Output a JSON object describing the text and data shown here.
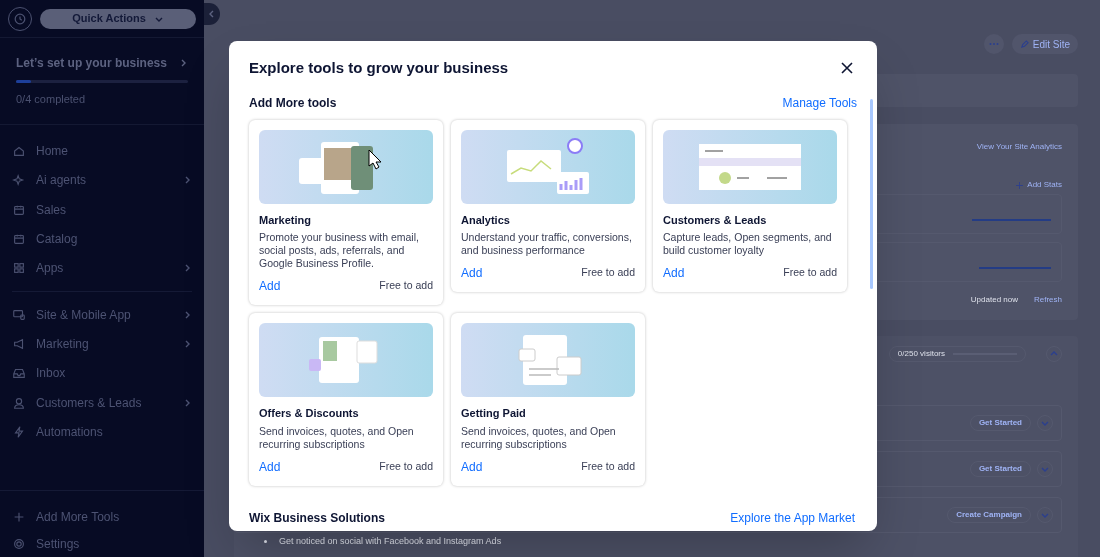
{
  "sidebar": {
    "quick_actions": "Quick Actions",
    "setup": {
      "title": "Let’s set up your business",
      "level": 0.09,
      "status": "0/4 completed"
    },
    "nav_groups": [
      [
        {
          "label": "Home",
          "kind": "link"
        },
        {
          "label": "Ai agents",
          "kind": "submenu"
        },
        {
          "label": "Sales",
          "kind": "link"
        },
        {
          "label": "Catalog",
          "kind": "link"
        },
        {
          "label": "Apps",
          "kind": "submenu"
        }
      ],
      [
        {
          "label": "Site & Mobile App",
          "kind": "submenu"
        },
        {
          "label": "Marketing",
          "kind": "submenu"
        },
        {
          "label": "Inbox",
          "kind": "link"
        },
        {
          "label": "Customers & Leads",
          "kind": "submenu"
        },
        {
          "label": "Automations",
          "kind": "link"
        }
      ]
    ],
    "footer": [
      {
        "label": "Add More Tools"
      },
      {
        "label": "Settings"
      }
    ]
  },
  "background": {
    "edit_site": "Edit Site",
    "view_analytics": "View Your Site Analytics",
    "add_stats": "Add Stats",
    "updated": "Updated now",
    "refresh": "Refresh",
    "visitors": "0/250 visitors",
    "actions": [
      {
        "label": "Get Started"
      },
      {
        "label": "Get Started"
      },
      {
        "label": "Create Campaign"
      }
    ],
    "bullet": "Get noticed on social with Facebook and Instagram Ads"
  },
  "modal": {
    "title": "Explore tools to grow your business",
    "section": "Add More tools",
    "manage": "Manage Tools",
    "cards": [
      {
        "kind": "marketing",
        "title": "Marketing",
        "description": "Promote your business with email, social posts, ads, referrals, and Google Business Profile.",
        "action": "Add",
        "price": "Free to add"
      },
      {
        "kind": "analytics",
        "title": "Analytics",
        "description": "Understand your traffic, conversions, and business performance",
        "action": "Add",
        "price": "Free to add"
      },
      {
        "kind": "contacts",
        "title": "Customers & Leads",
        "description": "Capture leads, Open segments, and build customer loyalty",
        "action": "Add",
        "price": "Free to add"
      },
      {
        "kind": "offers",
        "title": "Offers & Discounts",
        "description": "Send invoices, quotes, and Open recurring subscriptions",
        "action": "Add",
        "price": "Free to add"
      },
      {
        "kind": "payments",
        "title": "Getting Paid",
        "description": "Send invoices, quotes, and Open recurring subscriptions",
        "action": "Add",
        "price": "Free to add"
      }
    ],
    "footer_section": "Wix Business Solutions",
    "footer_link": "Explore the App Market"
  }
}
